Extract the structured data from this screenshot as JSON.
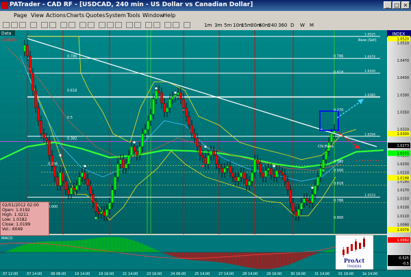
{
  "window": {
    "title": "PATrader - CAD RF - [USDCAD, 240 min - US Dollar vs Canadian Dollar]",
    "min": "_",
    "max": "□",
    "close": "×"
  },
  "menu": [
    "Page",
    "View",
    "Actions",
    "Charts",
    "Quotes",
    "System",
    "Tools",
    "Window",
    "Help"
  ],
  "timeframes": [
    "1m",
    "3m",
    "5m",
    "10m",
    "15m",
    "30m",
    "60m",
    "240",
    "360",
    "D",
    "W",
    "M"
  ],
  "chart": {
    "data_label": "Data",
    "closed_label": "CLOSED",
    "index_label": "INDEX",
    "base_label": "Base (Sell)",
    "cn_base_label": "CN Base",
    "bg": "#00777a",
    "fib_left": [
      {
        "label": "0.786",
        "price": 1.0475
      },
      {
        "label": "0.618",
        "price": 1.0396
      },
      {
        "label": "0.5",
        "price": 1.0333
      },
      {
        "label": "0.382",
        "price": 1.0285
      },
      {
        "label": "0.236",
        "price": 1.0226
      },
      {
        "label": "0.000",
        "price": 1.0127
      }
    ],
    "fib_right": [
      {
        "label": "0.786",
        "price": 1.0475
      },
      {
        "label": "0.618",
        "price": 1.0438
      },
      {
        "label": "0.270",
        "price": 1.0351
      },
      {
        "label": "0.382",
        "price": 1.0232
      },
      {
        "label": "0.500",
        "price": 1.0211
      },
      {
        "label": "0.618",
        "price": 1.0181
      },
      {
        "label": "0.786",
        "price": 1.0141
      },
      {
        "label": "0.800",
        "price": 1.0102
      }
    ],
    "hlines": [
      {
        "label": "1.0525",
        "price": 1.0525
      },
      {
        "label": "1.0474",
        "price": 1.0474
      },
      {
        "label": "1.0440",
        "price": 1.044
      },
      {
        "label": "1.0385",
        "price": 1.0385
      },
      {
        "label": "1.0294",
        "price": 1.0294
      },
      {
        "label": "1.0153",
        "price": 1.0153
      }
    ],
    "price_axis": [
      {
        "v": 1.051,
        "t": "1.0510"
      },
      {
        "v": 1.047,
        "t": "1.0470"
      },
      {
        "v": 1.043,
        "t": "1.0430"
      },
      {
        "v": 1.039,
        "t": "1.0390"
      },
      {
        "v": 1.035,
        "t": "1.0350"
      },
      {
        "v": 1.031,
        "t": "1.0310"
      },
      {
        "v": 1.027,
        "t": "1.0270"
      },
      {
        "v": 1.025,
        "t": "1.0250"
      },
      {
        "v": 1.023,
        "t": "1.0230"
      },
      {
        "v": 1.021,
        "t": "1.0210"
      },
      {
        "v": 1.019,
        "t": "1.0190"
      },
      {
        "v": 1.017,
        "t": "1.0170"
      },
      {
        "v": 1.015,
        "t": "1.0150"
      },
      {
        "v": 1.013,
        "t": "1.0130"
      },
      {
        "v": 1.011,
        "t": "1.0110"
      },
      {
        "v": 1.009,
        "t": "1.0090"
      }
    ],
    "price_tags": [
      {
        "v": 1.052,
        "t": "1.0520",
        "color": "#ffff00"
      },
      {
        "v": 1.03,
        "t": "1.0300",
        "color": "#ffff00"
      },
      {
        "v": 1.0273,
        "t": "1.0273",
        "color": "#ffffff"
      },
      {
        "v": 1.0255,
        "t": "1.0255",
        "color": "#00ff00"
      },
      {
        "v": 1.0198,
        "t": "1.0198",
        "color": "#ffff00"
      },
      {
        "v": 1.0078,
        "t": "1.0078",
        "color": "#ffff00"
      }
    ]
  },
  "ohlc": {
    "date": "02/01/2012 02:00",
    "open": "Open: 1.0192",
    "high": "High: 1.0211",
    "low": "Low: 1.0182",
    "close": "Close: 1.0199",
    "vol": "Vol.: 6049"
  },
  "macd": {
    "label": "MACD",
    "tags": [
      {
        "t": "1.0092",
        "color": "#ff0000"
      },
      {
        "t": "-0.525",
        "color": "#ffffff"
      },
      {
        "t": "-0.5",
        "color": "#ffffff"
      }
    ]
  },
  "dates": [
    "07 12:00",
    "07 14:00",
    "08 08:00",
    "19 14:00",
    "19 16:00",
    "21 14:00",
    "23 16:00",
    "24 06:00",
    "25 14:00",
    "27 14:00",
    "28 14:00",
    "29 16:00",
    "30 16:00",
    "31 14:00",
    "01 16:00",
    "1b 14:00"
  ],
  "logo": {
    "name": "ProAct",
    "sub": "TRADERS"
  },
  "colors": {
    "bull": "#00ff00",
    "bear": "#ff0000",
    "trend": "#ffffff",
    "band": "#c8c800",
    "ma": "#33ff33",
    "ma2": "#40c0ff"
  }
}
